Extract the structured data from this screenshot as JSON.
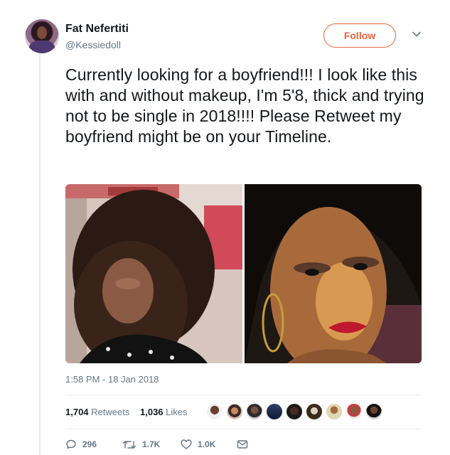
{
  "author": {
    "display_name": "Fat Nefertiti",
    "handle": "@Kessiedoll"
  },
  "follow_label": "Follow",
  "tweet_text": "Currently looking for a boyfriend!!! I look like this with and without makeup, I'm 5'8, thick and trying not to be single in 2018!!!! Please Retweet my boyfriend might be on your Timeline.",
  "timestamp": "1:58 PM - 18 Jan 2018",
  "stats": {
    "retweets_count": "1,704",
    "retweets_label": "Retweets",
    "likes_count": "1,036",
    "likes_label": "Likes"
  },
  "actions": {
    "reply_count": "296",
    "retweet_count": "1.7K",
    "like_count": "1.0K"
  },
  "colors": {
    "follow_accent": "#e8623a",
    "secondary_text": "#657786"
  }
}
